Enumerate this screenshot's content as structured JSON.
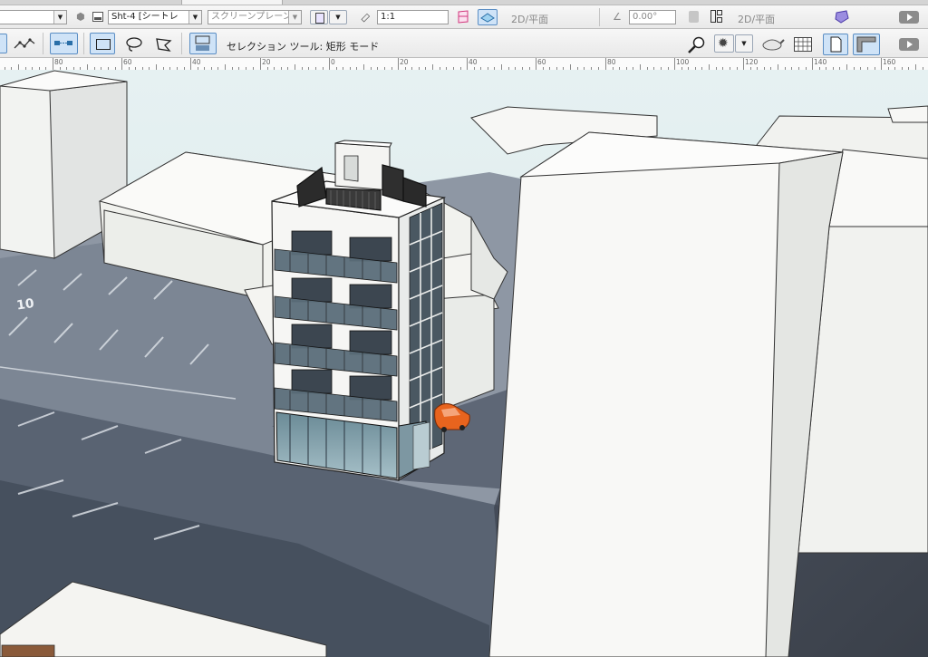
{
  "toolbar_top": {
    "class_value": "",
    "sheet_value": "Sht-4 [シートレ",
    "plane_value": "スクリーンプレーン",
    "scale_value": "1:1",
    "view_label_1": "2D/平面",
    "angle_value": "0.00°",
    "view_label_2": "2D/平面"
  },
  "toolbar_mode": {
    "status_text": "セレクション ツール: 矩形 モード"
  },
  "ruler": {
    "labels": [
      "80",
      "60",
      "40",
      "20",
      "0",
      "20",
      "40",
      "60",
      "80",
      "100",
      "120",
      "140",
      "160"
    ]
  },
  "viewport": {
    "parking_number": "10"
  },
  "colors": {
    "selected_button_bg": "#cfe3f7",
    "selected_button_border": "#5b8ec4",
    "car_orange": "#e8641e",
    "sky": "#e6f1f2"
  }
}
